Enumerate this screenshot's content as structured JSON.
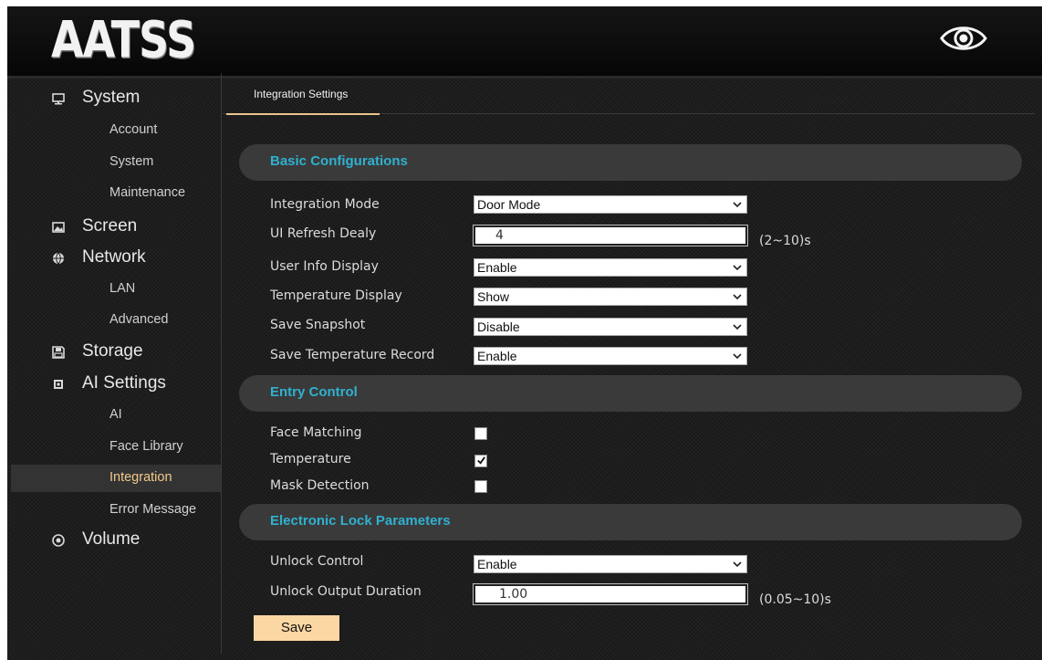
{
  "header": {
    "logo": "AATSS",
    "eye_icon": "eye-icon"
  },
  "sidebar": {
    "system": {
      "label": "System",
      "icon": "monitor-icon"
    },
    "account": "Account",
    "system_sub": "System",
    "maintenance": "Maintenance",
    "screen": {
      "label": "Screen",
      "icon": "picture-icon"
    },
    "network": {
      "label": "Network",
      "icon": "globe-icon"
    },
    "lan": "LAN",
    "advanced": "Advanced",
    "storage": {
      "label": "Storage",
      "icon": "floppy-icon"
    },
    "ai_settings": {
      "label": "AI Settings",
      "icon": "chip-icon"
    },
    "ai": "AI",
    "face_library": "Face Library",
    "integration": "Integration",
    "error_message": "Error Message",
    "volume": {
      "label": "Volume",
      "icon": "speaker-icon"
    }
  },
  "tabs": {
    "integration_settings": "Integration Settings"
  },
  "basic": {
    "title": "Basic Configurations",
    "integration_mode": {
      "label": "Integration Mode",
      "value": "Door Mode"
    },
    "ui_refresh": {
      "label": "UI Refresh Dealy",
      "value": "4",
      "unit": "(2~10)s"
    },
    "user_info": {
      "label": "User Info Display",
      "value": "Enable"
    },
    "temp_display": {
      "label": "Temperature Display",
      "value": "Show"
    },
    "save_snapshot": {
      "label": "Save Snapshot",
      "value": "Disable"
    },
    "save_temp_record": {
      "label": "Save Temperature Record",
      "value": "Enable"
    }
  },
  "entry": {
    "title": "Entry Control",
    "face_matching": {
      "label": "Face Matching",
      "checked": false
    },
    "temperature": {
      "label": "Temperature",
      "checked": true
    },
    "mask_detection": {
      "label": "Mask Detection",
      "checked": false
    }
  },
  "lock": {
    "title": "Electronic Lock Parameters",
    "unlock_control": {
      "label": "Unlock Control",
      "value": "Enable"
    },
    "unlock_duration": {
      "label": "Unlock Output Duration",
      "value": "1.00",
      "unit": "(0.05~10)s"
    }
  },
  "actions": {
    "save": "Save"
  },
  "colors": {
    "accent_section": "#2fb1d0",
    "active_nav_text": "#f3c98b",
    "save_button": "#fbd7a3"
  }
}
